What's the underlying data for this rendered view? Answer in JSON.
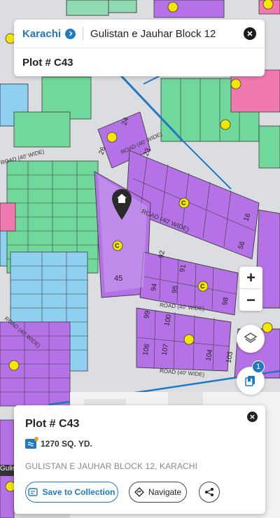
{
  "header": {
    "city": "Karachi",
    "search_value": "Gulistan e Jauhar Block 12",
    "plot_label": "Plot # C43"
  },
  "map": {
    "road_labels": [
      "ROAD (40' WIDE)",
      "ROAD (40' WIDE)",
      "ROAD (40' WIDE)",
      "ROAD (40' WIDE)",
      "ROAD (40' WIDE)",
      "ROAD (40' WIDE)"
    ],
    "plot_numbers": [
      "24",
      "26",
      "23",
      "16",
      "56",
      "92",
      "91",
      "94",
      "95",
      "98",
      "45",
      "99",
      "100",
      "106",
      "107",
      "104",
      "103",
      "C",
      "C",
      "C"
    ],
    "left_label": "Gulista",
    "layer_badge_count": "1"
  },
  "details": {
    "title": "Plot # C43",
    "area": "1270 SQ. YD.",
    "location": "GULISTAN E JAUHAR BLOCK 12, KARACHI",
    "save_label": "Save to Collection",
    "navigate_label": "Navigate"
  },
  "colors": {
    "accent": "#1f78c1",
    "plot_purple": "#b572e6",
    "plot_green": "#6fd89a",
    "plot_blue": "#8fcff0",
    "plot_pink": "#f07ab0",
    "road_gray": "#dcdde0"
  }
}
